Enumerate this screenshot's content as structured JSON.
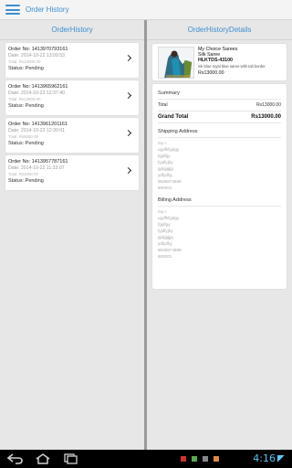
{
  "actionbar": {
    "title": "Order History"
  },
  "left_pane": {
    "header": "OrderHistory"
  },
  "orders": [
    {
      "no": "Order No: 1413970793161",
      "date": "Date: 2014-10-22 13:09:53",
      "total": "Total: Rs13000.00",
      "status": "Status: Pending"
    },
    {
      "no": "Order No: 1413965962161",
      "date": "Date: 2014-10-22 12:37:40",
      "total": "Total: Rs13000.00",
      "status": "Status: Pending"
    },
    {
      "no": "Order No: 1413961201161",
      "date": "Date: 2014-10-22 12:30:01",
      "total": "Total: Rs8000.00",
      "status": "Status: Pending"
    },
    {
      "no": "Order No: 1413957787161",
      "date": "Date: 2014-10-22 11:33:07",
      "total": "Total: Rs2000.00",
      "status": "Status: Pending"
    }
  ],
  "right_pane": {
    "header": "OrderHistoryDetails"
  },
  "product": {
    "brand": "My Choice Sarees",
    "name": "Silk Saree",
    "code": "HLKTDS-43100",
    "desc": "ink blue royal blue saree with tali border",
    "price": "Rs13000.00"
  },
  "summary": {
    "title": "Summary",
    "total_label": "Total",
    "total_value": "Rs13000.00",
    "grand_label": "Grand Total",
    "grand_value": "Rs13000.00"
  },
  "shipping": {
    "title": "Shipping Address",
    "lines": [
      "my c",
      "ugdfkfyjdgy",
      "fgjdfgy",
      "fyjdfyjhy",
      "gjdgjgjjg",
      "ydfydfyj",
      "9635874568",
      "600001"
    ]
  },
  "billing": {
    "title": "Billing Address",
    "lines": [
      "my c",
      "ugdfkfyjdgy",
      "fgjdfgy",
      "fyjdfyjhy",
      "gjdgjgjjg",
      "ydfydfyj",
      "9635874568",
      "600001"
    ]
  },
  "status_bar": {
    "time": "4:16"
  },
  "colors": {
    "accent": "#3d8fcf",
    "clock": "#5cc6f2"
  }
}
